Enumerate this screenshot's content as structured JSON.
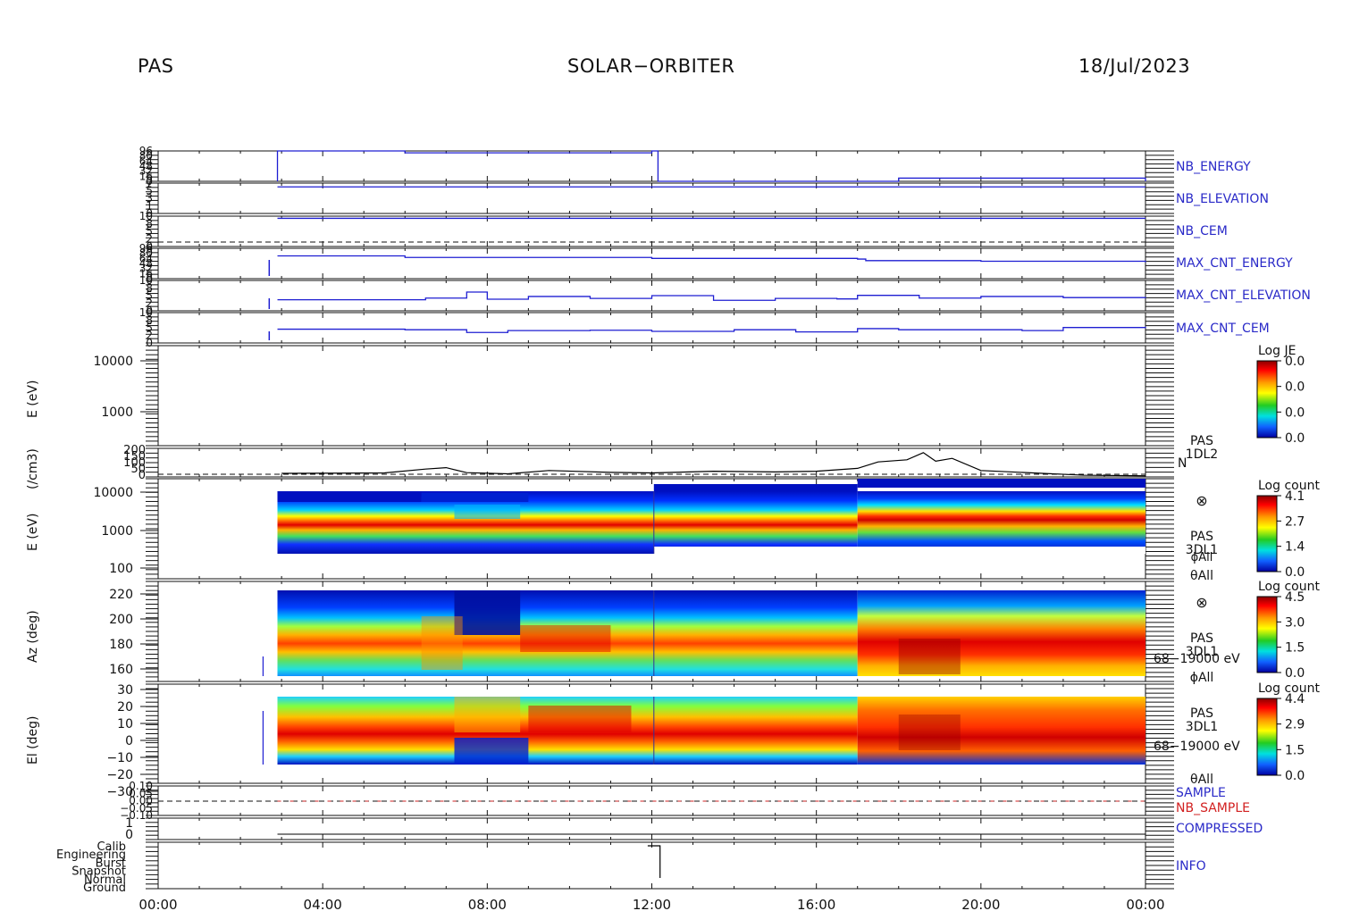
{
  "header": {
    "instrument": "PAS",
    "mission": "SOLAR−ORBITER",
    "date": "18/Jul/2023"
  },
  "x_axis": {
    "ticks": [
      "00:00",
      "04:00",
      "08:00",
      "12:00",
      "16:00",
      "20:00",
      "00:00"
    ]
  },
  "chart_data": [
    {
      "type": "line",
      "right_label": "NB_ENERGY",
      "ytick_labels": [
        "96",
        "80",
        "64",
        "48",
        "32",
        "16",
        "0"
      ],
      "x_hours": [
        2.9,
        2.9,
        6.0,
        6.0,
        12.0,
        12.0,
        12.15,
        12.15,
        18.0,
        18.0,
        24.0
      ],
      "y": [
        0,
        96,
        96,
        90,
        96,
        96,
        96,
        0,
        0,
        10,
        0
      ],
      "ylim": [
        0,
        96
      ]
    },
    {
      "type": "line",
      "right_label": "NB_ELEVATION",
      "ytick_labels": [
        "7",
        "5",
        "3",
        "1",
        "0"
      ],
      "x_hours": [
        2.9,
        24.0
      ],
      "y": [
        7,
        7
      ],
      "ylim": [
        0,
        8
      ]
    },
    {
      "type": "line",
      "right_label": "NB_CEM",
      "ytick_labels": [
        "10",
        "8",
        "5",
        "2",
        "0"
      ],
      "x_hours": [
        2.9,
        24.0
      ],
      "y": [
        10,
        10
      ],
      "ylim": [
        -3,
        11
      ]
    },
    {
      "type": "line",
      "right_label": "MAX_CNT_ENERGY",
      "ytick_labels": [
        "96",
        "80",
        "64",
        "48",
        "32",
        "16",
        "0"
      ],
      "x_hours": [
        2.9,
        3.5,
        6.0,
        9.0,
        12.0,
        15.0,
        17.0,
        17.2,
        20.0,
        24.0
      ],
      "y": [
        72,
        72,
        67,
        67,
        64,
        64,
        62,
        57,
        55,
        52
      ],
      "ylim": [
        0,
        96
      ]
    },
    {
      "type": "line",
      "right_label": "MAX_CNT_ELEVATION",
      "ytick_labels": [
        "10",
        "8",
        "5",
        "2",
        "0"
      ],
      "x_hours": [
        2.9,
        5.0,
        6.5,
        7.5,
        8.0,
        9.0,
        10.5,
        12.0,
        13.5,
        15.0,
        16.5,
        17.0,
        18.5,
        20.0,
        22.0,
        24.0
      ],
      "y": [
        4,
        4,
        4.6,
        6.8,
        4.2,
        5.2,
        4.5,
        5.5,
        3.8,
        4.5,
        4.3,
        5.6,
        4.6,
        5.2,
        4.8,
        5.0
      ],
      "ylim": [
        0,
        11
      ]
    },
    {
      "type": "line",
      "right_label": "MAX_CNT_CEM",
      "ytick_labels": [
        "10",
        "8",
        "5",
        "2",
        "0"
      ],
      "x_hours": [
        2.9,
        6.0,
        7.5,
        8.5,
        10.5,
        12.0,
        14.0,
        15.5,
        17.0,
        18.0,
        21.0,
        22.0,
        24.0
      ],
      "y": [
        5,
        4.8,
        3.8,
        4.5,
        4.6,
        4.2,
        4.8,
        4.0,
        5.2,
        4.8,
        4.5,
        5.6,
        5.9
      ],
      "ylim": [
        0,
        11
      ]
    },
    {
      "type": "heatmap",
      "ylabel": "E (eV)",
      "ytick_labels": [
        "10000",
        "1000"
      ],
      "colorbar": {
        "label": "Log JE",
        "ticks": [
          "0.0",
          "0.0",
          "0.0",
          "0.0"
        ]
      }
    },
    {
      "type": "line",
      "ylabel": "(/cm3)",
      "ytick_labels": [
        "200",
        "150",
        "100",
        "50",
        "0"
      ],
      "right_labels": [
        "PAS",
        "1DL2",
        "N"
      ],
      "x_hours": [
        3.0,
        5.5,
        6.5,
        7.0,
        7.5,
        8.5,
        9.5,
        11.0,
        12.0,
        13.5,
        15.0,
        16.0,
        17.0,
        17.5,
        18.2,
        18.6,
        18.9,
        19.3,
        20.0,
        21.5,
        22.5,
        24.0
      ],
      "y": [
        25,
        28,
        55,
        65,
        30,
        22,
        45,
        32,
        28,
        40,
        35,
        40,
        60,
        105,
        120,
        170,
        110,
        130,
        45,
        25,
        12,
        8
      ],
      "ylim": [
        0,
        200
      ]
    },
    {
      "type": "heatmap",
      "ylabel": "E (eV)",
      "ytick_labels": [
        "10000",
        "1000",
        "100"
      ],
      "right_labels": [
        "⊗",
        "PAS",
        "3DL1",
        "ϕAll",
        "θAll"
      ],
      "colorbar": {
        "label": "Log count",
        "ticks": [
          "4.1",
          "2.7",
          "1.4",
          "0.0"
        ]
      }
    },
    {
      "type": "heatmap",
      "ylabel": "Az (deg)",
      "ytick_labels": [
        "220",
        "200",
        "180",
        "160"
      ],
      "right_labels": [
        "⊗",
        "PAS",
        "3DL1",
        "68−19000 eV",
        "ϕAll"
      ],
      "colorbar": {
        "label": "Log count",
        "ticks": [
          "4.5",
          "3.0",
          "1.5",
          "0.0"
        ]
      }
    },
    {
      "type": "heatmap",
      "ylabel": "El (deg)",
      "ytick_labels": [
        "30",
        "20",
        "10",
        "0",
        "−10",
        "−20",
        "−30"
      ],
      "right_labels": [
        "PAS",
        "3DL1",
        "68−19000 eV",
        "θAll"
      ],
      "colorbar": {
        "label": "Log count",
        "ticks": [
          "4.4",
          "2.9",
          "1.5",
          "0.0"
        ]
      }
    },
    {
      "type": "line",
      "ytick_labels": [
        "0.10",
        "0.05",
        "0.00",
        "−0.05",
        "−0.10"
      ],
      "right_labels": [
        "SAMPLE",
        "NB_SAMPLE"
      ]
    },
    {
      "type": "line",
      "ytick_labels": [
        "1",
        "0"
      ],
      "right_label": "COMPRESSED"
    },
    {
      "type": "line",
      "ytick_labels": [
        "Calib",
        "Engineering",
        "Burst",
        "Snapshot",
        "Normal",
        "Ground"
      ],
      "right_label": "INFO"
    }
  ],
  "colors": {
    "blue_label": "#2a2ac8",
    "line_blue": "#1e1ed2",
    "red_label": "#d22020",
    "axis": "#111111"
  }
}
